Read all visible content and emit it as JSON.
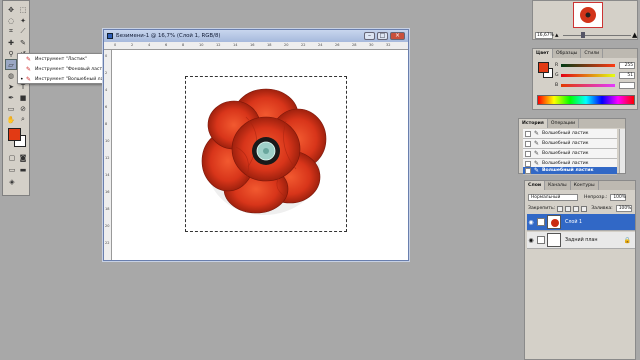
{
  "toolbox": {
    "tools": [
      {
        "name": "move-tool-icon",
        "glyph": "✥"
      },
      {
        "name": "marquee-tool-icon",
        "glyph": "⬚"
      },
      {
        "name": "lasso-tool-icon",
        "glyph": "◌"
      },
      {
        "name": "magic-wand-tool-icon",
        "glyph": "✦"
      },
      {
        "name": "crop-tool-icon",
        "glyph": "⌗"
      },
      {
        "name": "slice-tool-icon",
        "glyph": "⟋"
      },
      {
        "name": "healing-brush-icon",
        "glyph": "✚"
      },
      {
        "name": "brush-tool-icon",
        "glyph": "✎"
      },
      {
        "name": "clone-stamp-icon",
        "glyph": "⚲"
      },
      {
        "name": "history-brush-icon",
        "glyph": "↺"
      },
      {
        "name": "eraser-tool-icon",
        "glyph": "▱"
      },
      {
        "name": "gradient-tool-icon",
        "glyph": "▤"
      },
      {
        "name": "blur-tool-icon",
        "glyph": "◍"
      },
      {
        "name": "dodge-tool-icon",
        "glyph": "●"
      },
      {
        "name": "path-selection-icon",
        "glyph": "➤"
      },
      {
        "name": "type-tool-icon",
        "glyph": "T"
      },
      {
        "name": "pen-tool-icon",
        "glyph": "✒"
      },
      {
        "name": "shape-tool-icon",
        "glyph": "■"
      },
      {
        "name": "notes-tool-icon",
        "glyph": "▭"
      },
      {
        "name": "eyedropper-tool-icon",
        "glyph": "⊘"
      },
      {
        "name": "hand-tool-icon",
        "glyph": "✋"
      },
      {
        "name": "zoom-tool-icon",
        "glyph": "⌕"
      }
    ],
    "foreground_color": "#e23a14",
    "background_color": "#ffffff"
  },
  "flyout": {
    "items": [
      {
        "label": "Инструмент \"Ластик\"",
        "key": "E",
        "selected": false
      },
      {
        "label": "Инструмент \"Фоновый ластик\"",
        "key": "E",
        "selected": false
      },
      {
        "label": "Инструмент \"Волшебный ластик\"",
        "key": "E",
        "selected": true
      }
    ]
  },
  "document": {
    "title": "Безимени-1 @ 16,7% (Слой 1, RGB/8)",
    "ruler_ticks": [
      "0",
      "2",
      "4",
      "6",
      "8",
      "10",
      "12",
      "14",
      "16",
      "18",
      "20",
      "22",
      "24",
      "26",
      "28",
      "30",
      "32"
    ],
    "ruler_left_ticks": [
      "0",
      "2",
      "4",
      "6",
      "8",
      "10",
      "12",
      "14",
      "16",
      "18",
      "20",
      "22"
    ]
  },
  "navigator": {
    "zoom": "16,67%"
  },
  "color_panel": {
    "tabs": [
      "Цвет",
      "Образцы",
      "Стили"
    ],
    "channels": [
      {
        "ch": "R",
        "value": "255",
        "gradient": "linear-gradient(90deg,#003a14,#ff3a14)"
      },
      {
        "ch": "G",
        "value": "51",
        "gradient": "linear-gradient(90deg,#e20014,#e2ff14)"
      },
      {
        "ch": "B",
        "value": "",
        "gradient": "linear-gradient(90deg,#e23a00,#e23aff)"
      }
    ]
  },
  "history": {
    "tabs": [
      "История",
      "Операции"
    ],
    "rows": [
      {
        "label": "Волшебный ластик",
        "active": false
      },
      {
        "label": "Волшебный ластик",
        "active": false
      },
      {
        "label": "Волшебный ластик",
        "active": false
      },
      {
        "label": "Волшебный ластик",
        "active": false
      },
      {
        "label": "Волшебный ластик",
        "active": true
      }
    ]
  },
  "layers": {
    "tabs": [
      "Слои",
      "Каналы",
      "Контуры"
    ],
    "blend_mode": "Нормальный",
    "opacity_label": "Непрозр.:",
    "opacity_value": "100%",
    "lock_label": "Закрепить:",
    "fill_label": "Заливка:",
    "fill_value": "100%",
    "rows": [
      {
        "name": "Слой 1",
        "active": true
      },
      {
        "name": "Задний план",
        "active": false
      }
    ]
  }
}
